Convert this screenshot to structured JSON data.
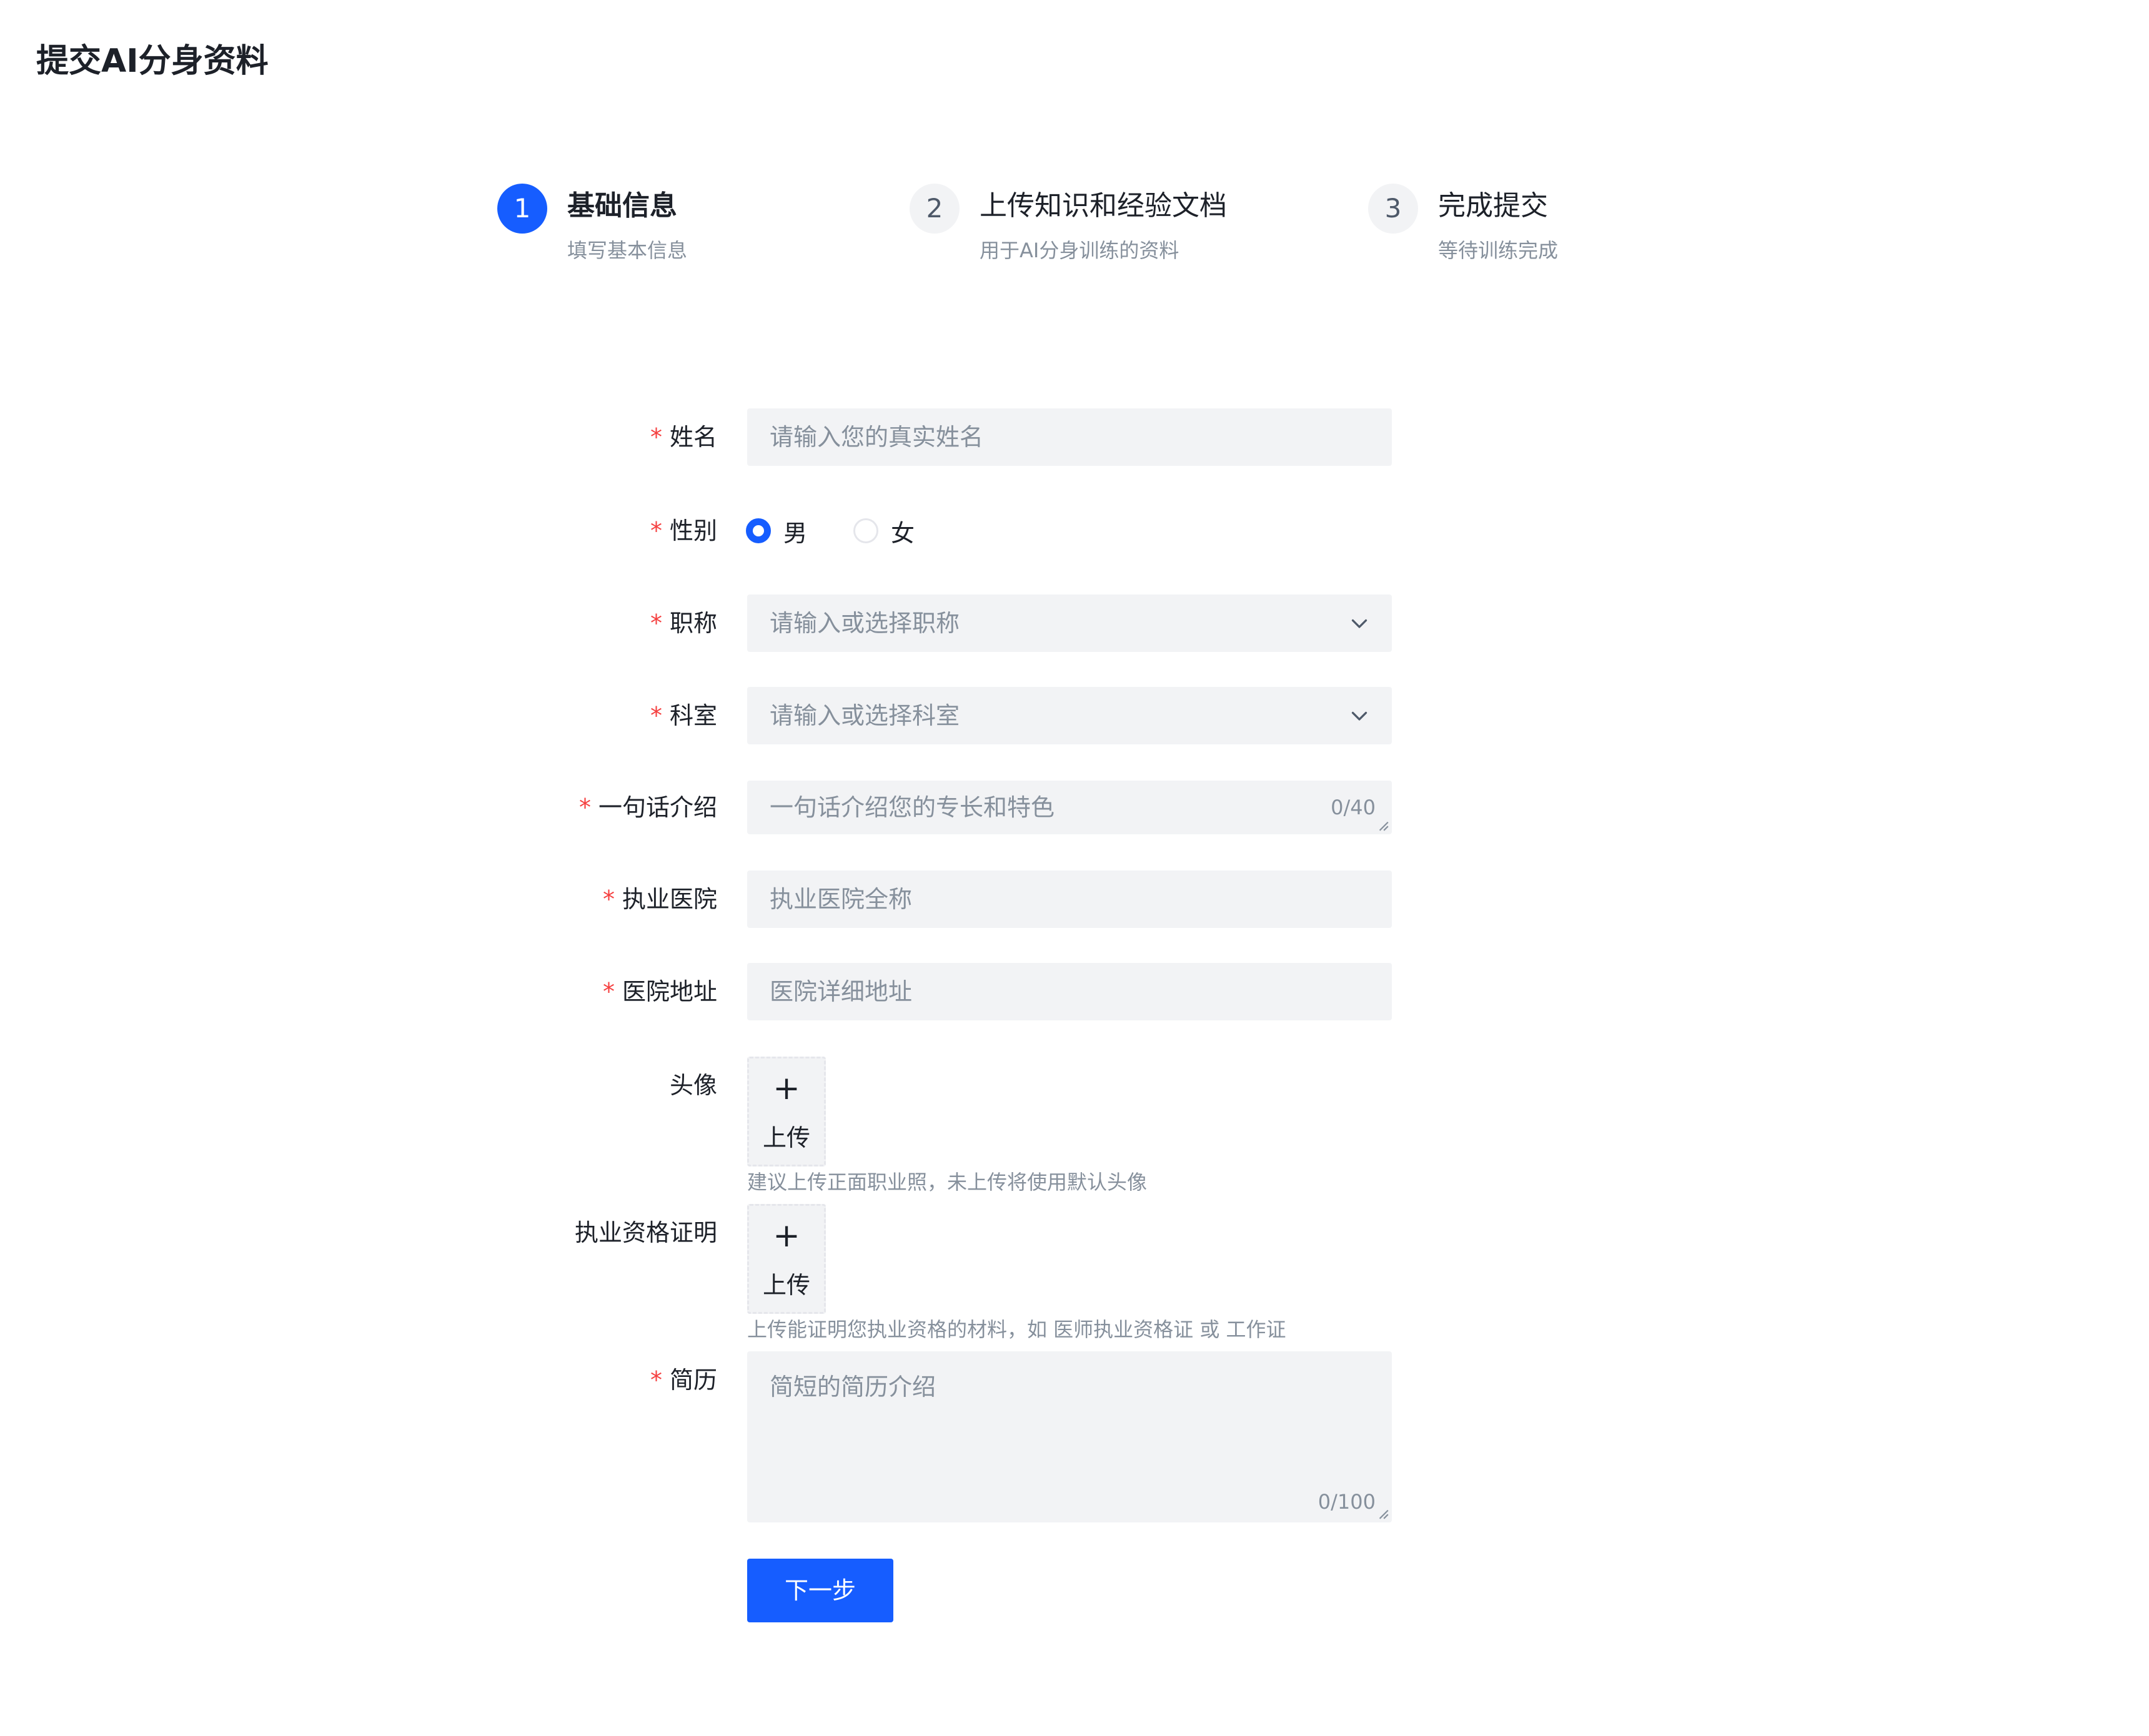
{
  "page": {
    "title": "提交AI分身资料"
  },
  "steps": [
    {
      "number": "1",
      "title": "基础信息",
      "desc": "填写基本信息"
    },
    {
      "number": "2",
      "title": "上传知识和经验文档",
      "desc": "用于AI分身训练的资料"
    },
    {
      "number": "3",
      "title": "完成提交",
      "desc": "等待训练完成"
    }
  ],
  "form": {
    "required_mark": "*",
    "name": {
      "label": "姓名",
      "placeholder": "请输入您的真实姓名",
      "value": ""
    },
    "gender": {
      "label": "性别",
      "options": [
        "男",
        "女"
      ],
      "selected": "男"
    },
    "title_field": {
      "label": "职称",
      "placeholder": "请输入或选择职称",
      "value": ""
    },
    "department": {
      "label": "科室",
      "placeholder": "请输入或选择科室",
      "value": ""
    },
    "intro": {
      "label": "一句话介绍",
      "placeholder": "一句话介绍您的专长和特色",
      "count": "0/40",
      "value": ""
    },
    "hospital": {
      "label": "执业医院",
      "placeholder": "执业医院全称",
      "value": ""
    },
    "address": {
      "label": "医院地址",
      "placeholder": "医院详细地址",
      "value": ""
    },
    "avatar": {
      "label": "头像",
      "upload_plus": "+",
      "upload_label": "上传",
      "hint": "建议上传正面职业照，未上传将使用默认头像"
    },
    "certificate": {
      "label": "执业资格证明",
      "upload_plus": "+",
      "upload_label": "上传",
      "hint": "上传能证明您执业资格的材料，如 医师执业资格证 或 工作证"
    },
    "resume": {
      "label": "简历",
      "placeholder": "简短的简历介绍",
      "count": "0/100",
      "value": ""
    },
    "next_label": "下一步"
  },
  "colors": {
    "primary": "#165dff",
    "required": "#f53f3f",
    "field_bg": "#f2f3f5",
    "placeholder": "#86909c",
    "text": "#1d2129"
  },
  "icons": {
    "select_arrow": "chevron-down-icon",
    "textarea_resize": "resize-handle-icon"
  }
}
